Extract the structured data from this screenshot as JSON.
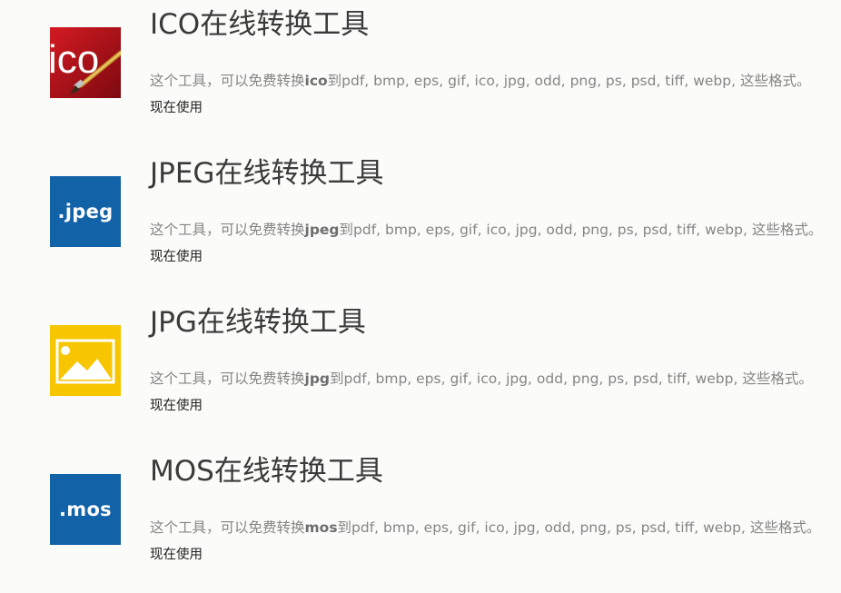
{
  "tools": [
    {
      "title": "ICO在线转换工具",
      "icon": "ico-paintbrush-icon",
      "desc_prefix": "这个工具，可以免费转换",
      "format": "ico",
      "desc_suffix": "到pdf, bmp, eps, gif, ico, jpg, odd, png, ps, psd, tiff, webp, 这些格式。",
      "link": "现在使用"
    },
    {
      "title": "JPEG在线转换工具",
      "icon": "jpeg-file-icon",
      "icon_text": ".jpeg",
      "desc_prefix": "这个工具，可以免费转换",
      "format": "jpeg",
      "desc_suffix": "到pdf, bmp, eps, gif, ico, jpg, odd, png, ps, psd, tiff, webp, 这些格式。",
      "link": "现在使用"
    },
    {
      "title": "JPG在线转换工具",
      "icon": "image-picture-icon",
      "desc_prefix": "这个工具，可以免费转换",
      "format": "jpg",
      "desc_suffix": "到pdf, bmp, eps, gif, ico, jpg, odd, png, ps, psd, tiff, webp, 这些格式。",
      "link": "现在使用"
    },
    {
      "title": "MOS在线转换工具",
      "icon": "mos-file-icon",
      "icon_text": ".mos",
      "desc_prefix": "这个工具，可以免费转换",
      "format": "mos",
      "desc_suffix": "到pdf, bmp, eps, gif, ico, jpg, odd, png, ps, psd, tiff, webp, 这些格式。",
      "link": "现在使用"
    }
  ],
  "ico_icon_text": "ico",
  "colors": {
    "background": "#fbfbfa",
    "file_icon_blue": "#1262a8",
    "image_icon_yellow": "#f7c600",
    "ico_icon_red": "#b3141b",
    "title_text": "#3a3a3a",
    "desc_text": "#858585"
  }
}
